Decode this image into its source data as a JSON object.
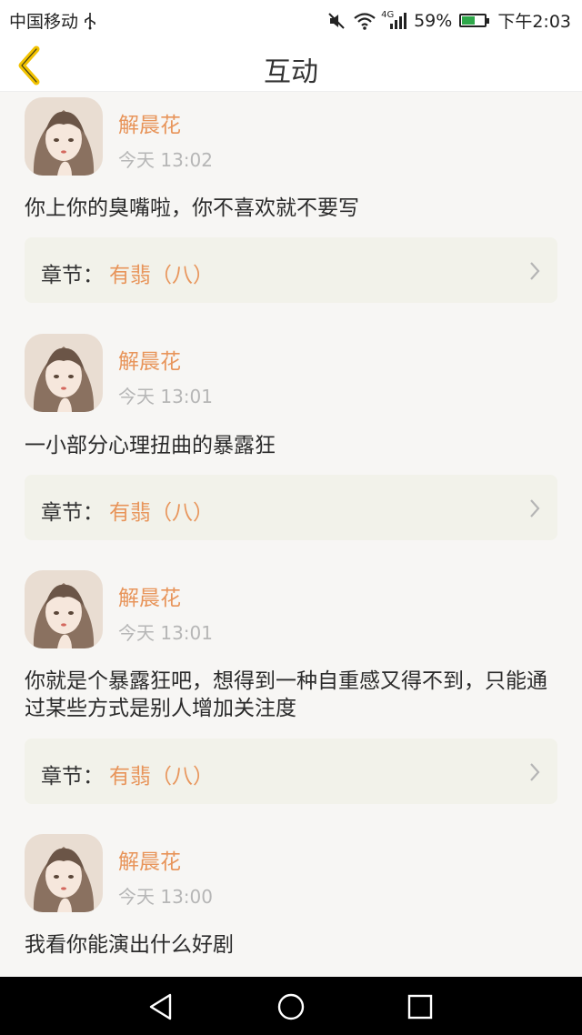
{
  "status_bar": {
    "carrier": "中国移动",
    "network": "4G",
    "battery": "59%",
    "battery_level": 0.59,
    "time": "下午2:03"
  },
  "header": {
    "title": "互动"
  },
  "comments": [
    {
      "user": "解晨花",
      "time": "今天 13:02",
      "content": "你上你的臭嘴啦，你不喜欢就不要写",
      "chapter_label": "章节：",
      "chapter_name": "有翡（八）"
    },
    {
      "user": "解晨花",
      "time": "今天 13:01",
      "content": "一小部分心理扭曲的暴露狂",
      "chapter_label": "章节：",
      "chapter_name": "有翡（八）"
    },
    {
      "user": "解晨花",
      "time": "今天 13:01",
      "content": "你就是个暴露狂吧，想得到一种自重感又得不到，只能通过某些方式是别人增加关注度",
      "chapter_label": "章节：",
      "chapter_name": "有翡（八）"
    },
    {
      "user": "解晨花",
      "time": "今天 13:00",
      "content": "我看你能演出什么好剧"
    }
  ],
  "colors": {
    "accent": "#e8955b",
    "back_icon": "#f2c200",
    "chapter_bg": "#f2f2ea"
  },
  "icons": [
    "usb-icon",
    "mute-icon",
    "wifi-icon",
    "signal-icon",
    "battery-icon",
    "back-chevron-icon",
    "avatar",
    "chevron-right-icon",
    "nav-back-icon",
    "nav-home-icon",
    "nav-recents-icon"
  ]
}
